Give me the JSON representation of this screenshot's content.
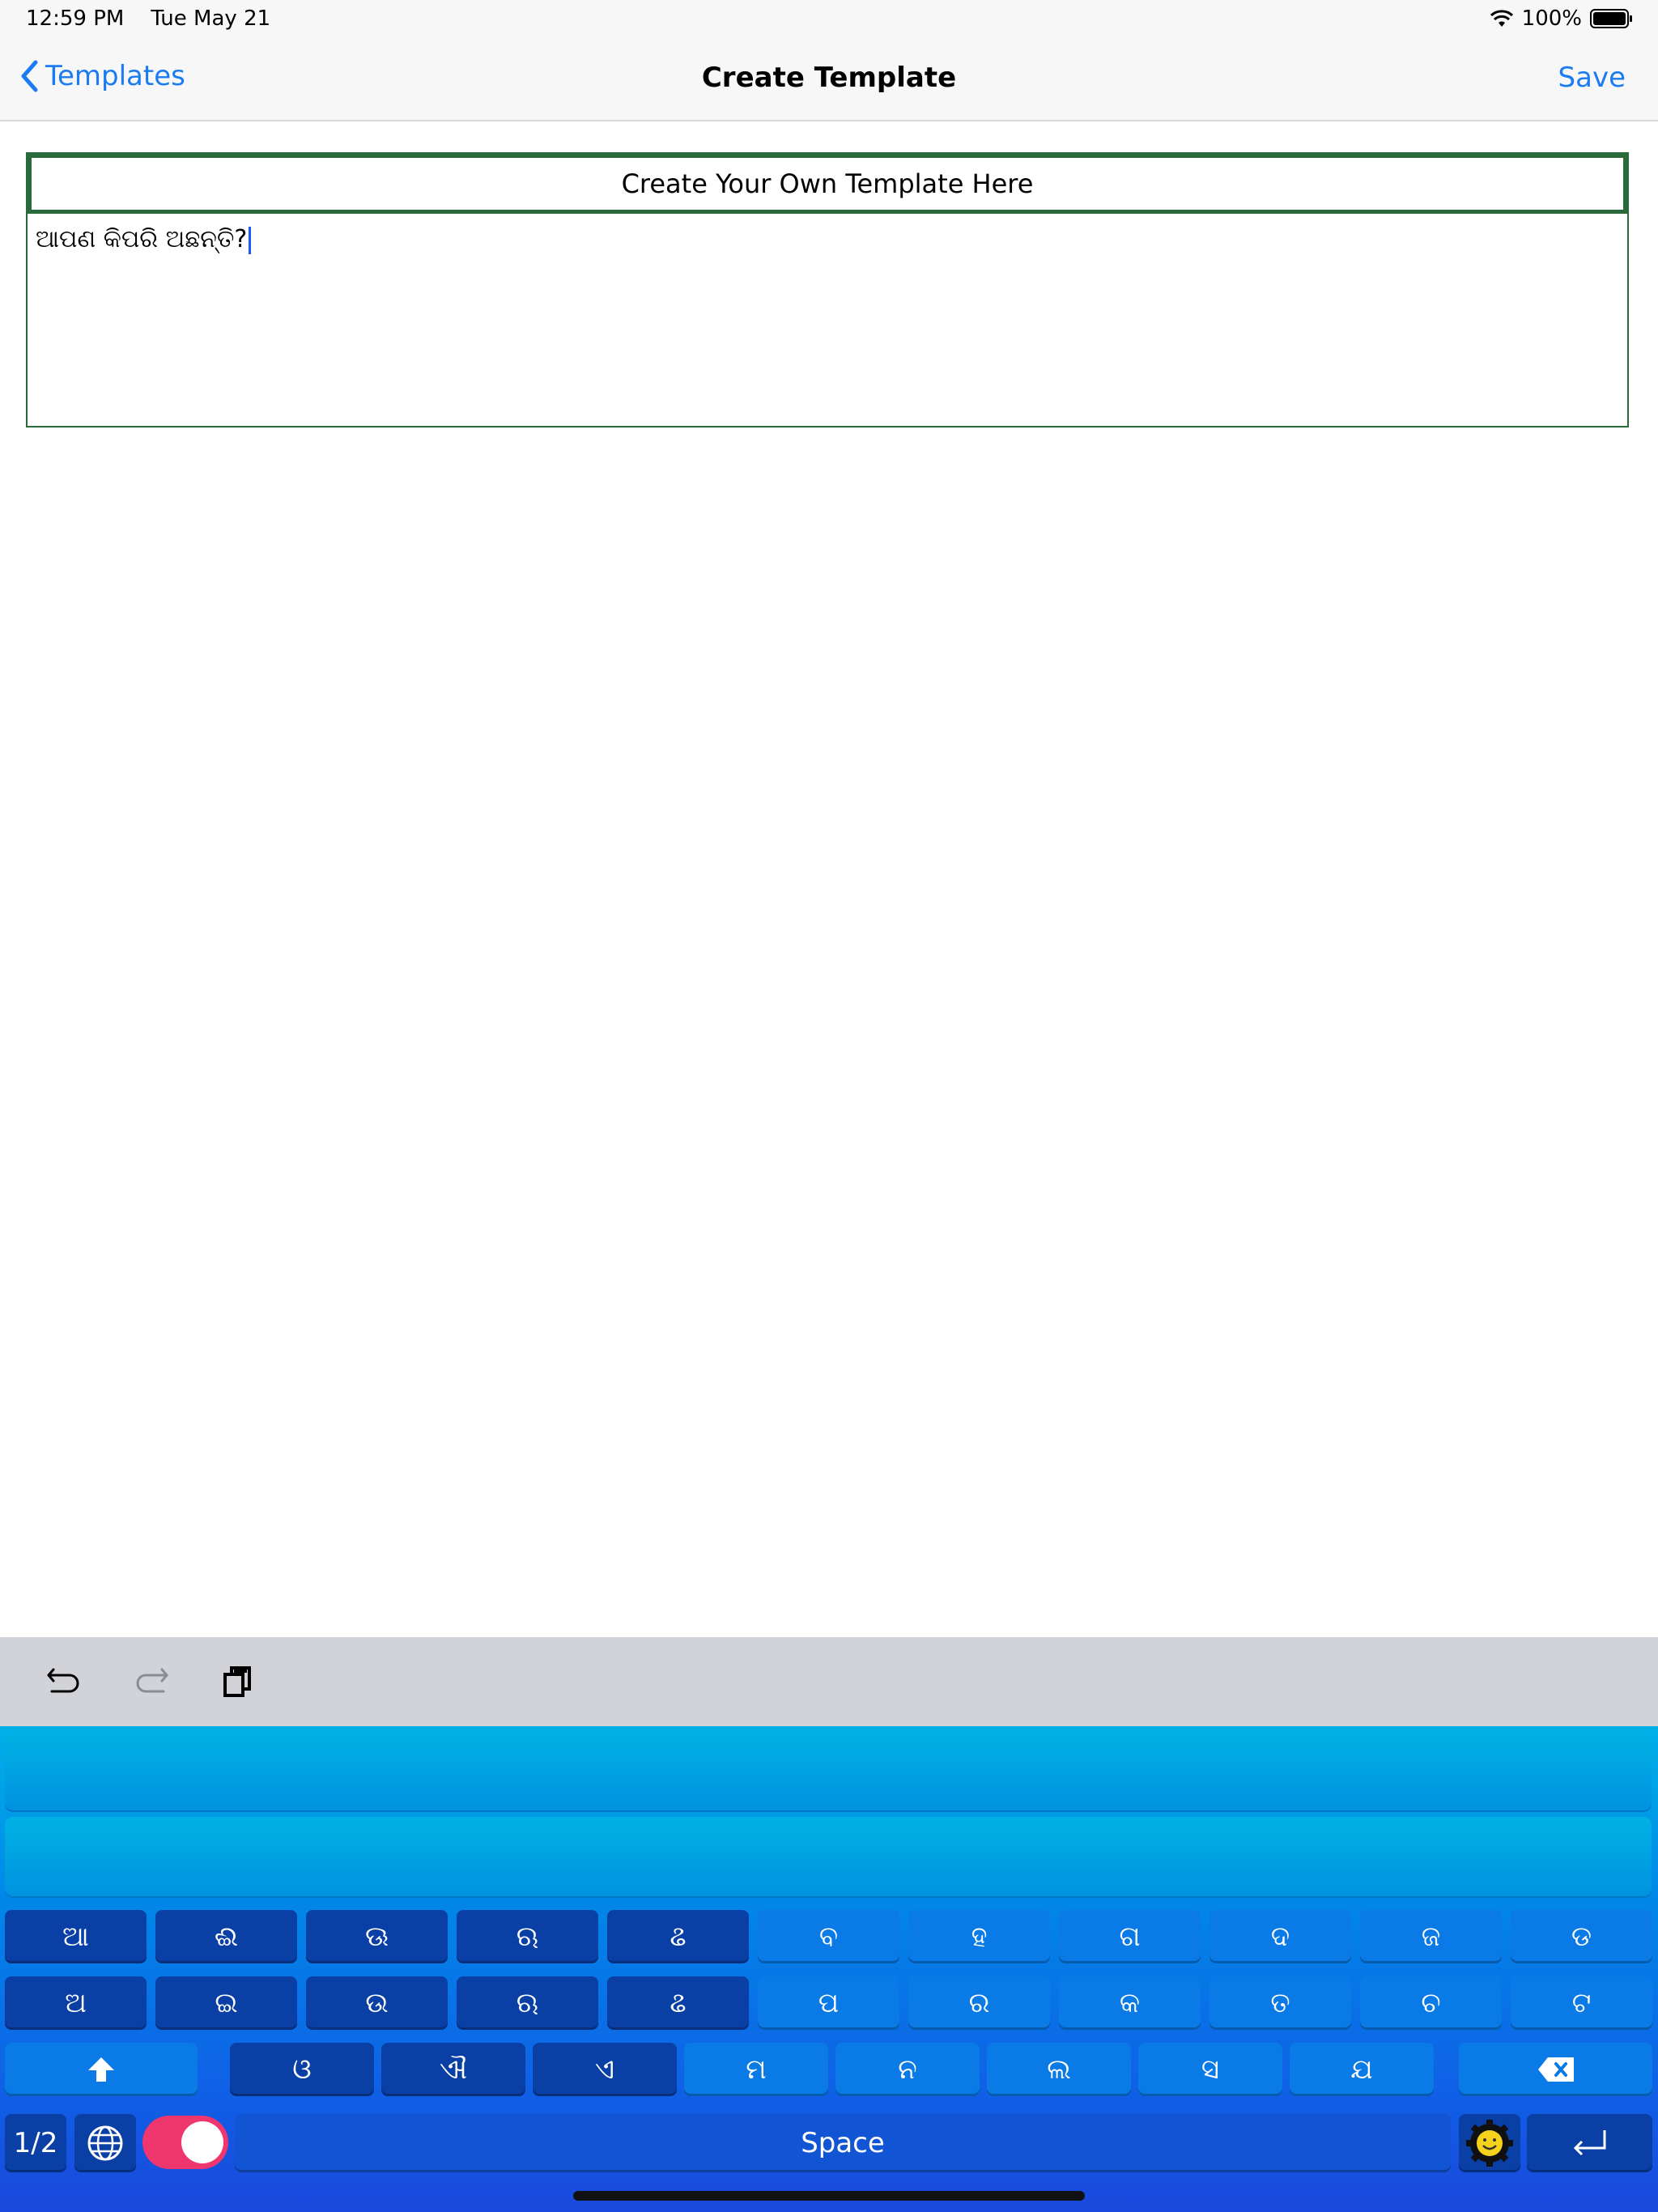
{
  "status": {
    "time": "12:59 PM",
    "date": "Tue May 21",
    "battery": "100%"
  },
  "nav": {
    "back_label": "Templates",
    "title": "Create Template",
    "save_label": "Save"
  },
  "template": {
    "header": "Create Your Own Template Here",
    "text": "ଆପଣ କିପରି ଅଛନ୍ତି?"
  },
  "keyboard": {
    "row1": [
      "ଆ",
      "ଈ",
      "ଊ",
      "ଋ",
      "ଌ",
      "ବ",
      "ହ",
      "ଗ",
      "ଦ",
      "ଜ",
      "ଡ"
    ],
    "row2": [
      "ଅ",
      "ଇ",
      "ଉ",
      "ଋ",
      "ଌ",
      "ପ",
      "ର",
      "କ",
      "ତ",
      "ଚ",
      "ଟ"
    ],
    "row3": [
      "ଓ",
      "ଐ",
      "ଏ",
      "ମ",
      "ନ",
      "ଲ",
      "ସ",
      "ଯ"
    ],
    "page_label": "1/2",
    "space_label": "Space"
  }
}
